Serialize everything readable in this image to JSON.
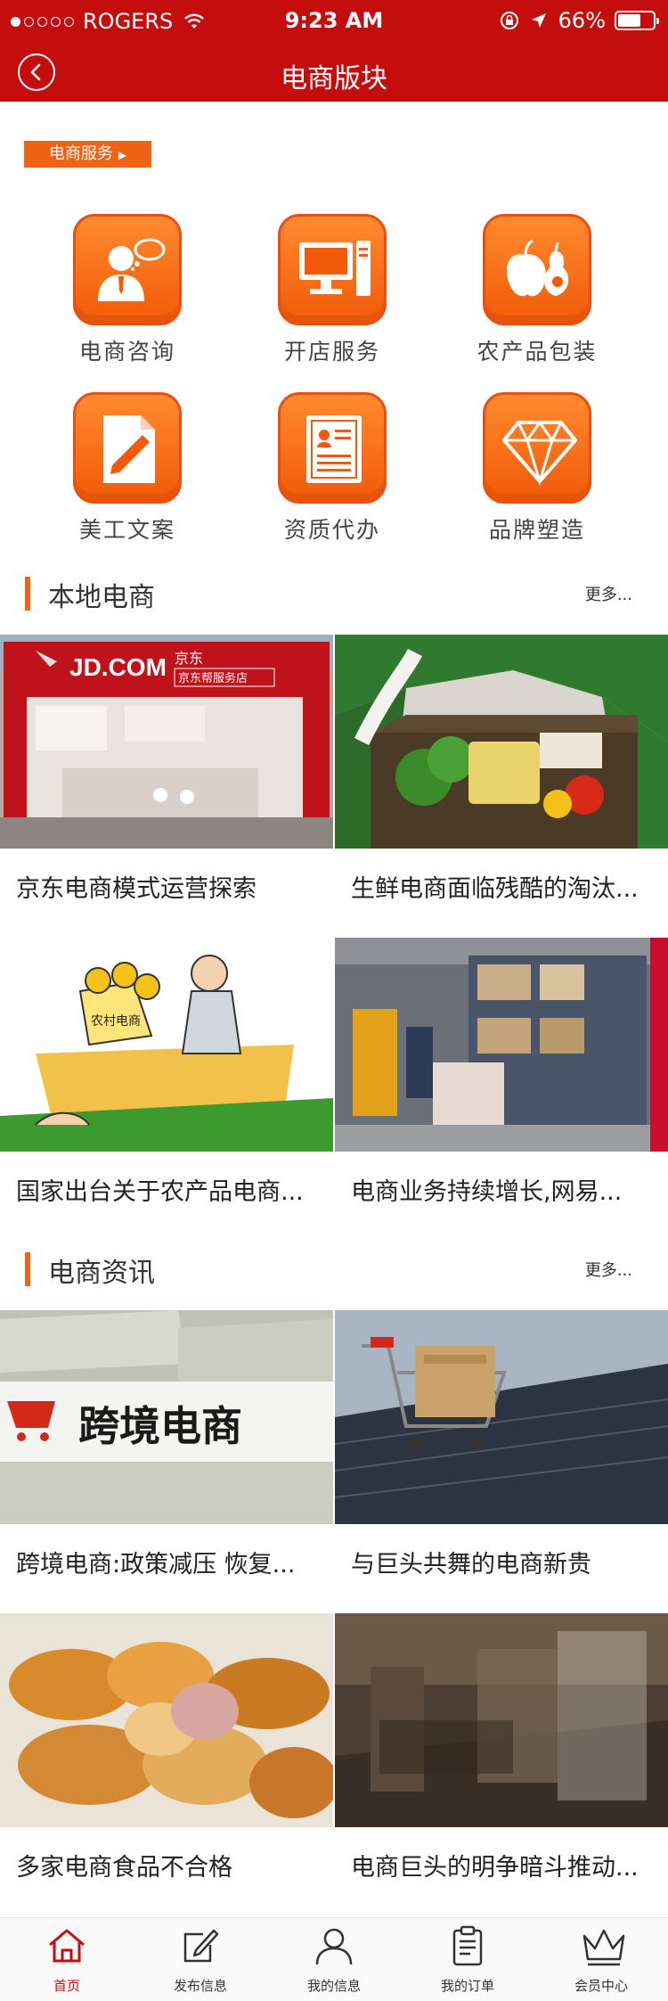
{
  "status_bar": {
    "carrier": "ROGERS",
    "time": "9:23 AM",
    "battery": "66%",
    "battery_level": 0.66
  },
  "nav": {
    "title": "电商版块",
    "back_icon": "chevron-left-icon"
  },
  "service_tag": "电商服务",
  "services": [
    {
      "label": "电商咨询",
      "icon": "consultant-icon"
    },
    {
      "label": "开店服务",
      "icon": "computer-icon"
    },
    {
      "label": "农产品包装",
      "icon": "fruit-icon"
    },
    {
      "label": "美工文案",
      "icon": "document-pen-icon"
    },
    {
      "label": "资质代办",
      "icon": "certificate-icon"
    },
    {
      "label": "品牌塑造",
      "icon": "diamond-icon"
    }
  ],
  "sections": [
    {
      "title": "本地电商",
      "more": "更多...",
      "articles": [
        {
          "title": "京东电商模式运营探索"
        },
        {
          "title": "生鲜电商面临残酷的淘汰..."
        },
        {
          "title": "国家出台关于农产品电商..."
        },
        {
          "title": "电商业务持续增长,网易..."
        }
      ]
    },
    {
      "title": "电商资讯",
      "more": "更多...",
      "articles": [
        {
          "title": "跨境电商:政策减压 恢复..."
        },
        {
          "title": "与巨头共舞的电商新贵"
        },
        {
          "title": "多家电商食品不合格"
        },
        {
          "title": "电商巨头的明争暗斗推动..."
        }
      ]
    }
  ],
  "image_text": {
    "jd_logo": "JD.COM",
    "jd_cn": "京东",
    "jd_store": "京东帮服务店",
    "rural_sign": "农村电商",
    "cross_border_sign": "跨境电商"
  },
  "tabs": [
    {
      "label": "首页",
      "icon": "home-icon",
      "active": true
    },
    {
      "label": "发布信息",
      "icon": "edit-icon",
      "active": false
    },
    {
      "label": "我的信息",
      "icon": "user-icon",
      "active": false
    },
    {
      "label": "我的订单",
      "icon": "clipboard-icon",
      "active": false
    },
    {
      "label": "会员中心",
      "icon": "crown-icon",
      "active": false
    }
  ],
  "colors": {
    "brand_red": "#c40d0d",
    "accent_orange": "#f06314"
  }
}
